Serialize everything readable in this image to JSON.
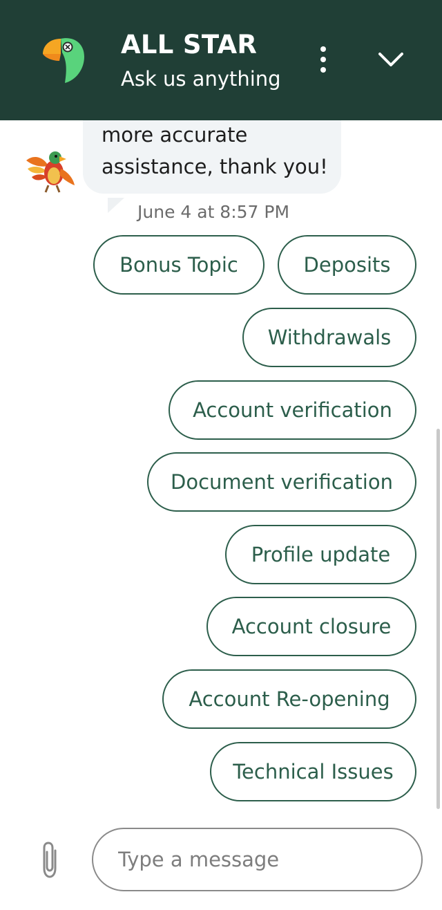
{
  "colors": {
    "header_bg": "#203f36",
    "accent": "#2c5e4b",
    "bubble_bg": "#f1f4f6"
  },
  "header": {
    "title": "ALL STAR",
    "subtitle": "Ask us anything",
    "logo_icon": "parrot-logo-icon",
    "menu_icon": "more-vertical-icon",
    "collapse_icon": "chevron-down-icon"
  },
  "message": {
    "lines": [
      "more accurate",
      "assistance, thank you!"
    ],
    "timestamp": "June 4 at 8:57 PM",
    "avatar_icon": "parrot-avatar-icon"
  },
  "quick_replies": [
    "Bonus Topic",
    "Deposits",
    "Withdrawals",
    "Account verification",
    "Document verification",
    "Profile update",
    "Account closure",
    "Account Re-opening",
    "Technical Issues"
  ],
  "composer": {
    "placeholder": "Type a message",
    "attach_icon": "paperclip-icon"
  }
}
